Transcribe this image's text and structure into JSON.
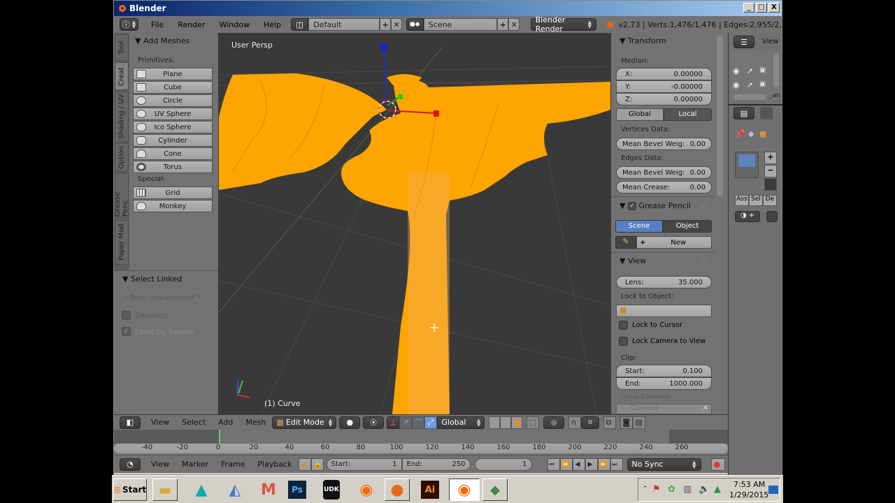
{
  "window": {
    "title": "Blender",
    "controls": [
      "_",
      "□",
      "X"
    ]
  },
  "topbar": {
    "menus": [
      "File",
      "Render",
      "Window",
      "Help"
    ],
    "screen_layout": "Default",
    "scene": "Scene",
    "render_engine": "Blender Render",
    "stats": "v2.73 | Verts:1,476/1,476 | Edges:2,955/2,"
  },
  "toolshelf": {
    "tabs": [
      "Tool",
      "Creat",
      "Shading / UV",
      "Option",
      "Grease Penc",
      "Paper Mod"
    ],
    "active_tab": "Creat",
    "panel_title": "Add Meshes",
    "primitives_label": "Primitives:",
    "primitives": [
      {
        "label": "Plane",
        "icon": "plane-icon"
      },
      {
        "label": "Cube",
        "icon": "cube-icon"
      },
      {
        "label": "Circle",
        "icon": "circle-icon"
      },
      {
        "label": "UV Sphere",
        "icon": "uv-sphere-icon"
      },
      {
        "label": "Ico Sphere",
        "icon": "ico-sphere-icon"
      },
      {
        "label": "Cylinder",
        "icon": "cylinder-icon"
      },
      {
        "label": "Cone",
        "icon": "cone-icon"
      },
      {
        "label": "Torus",
        "icon": "torus-icon"
      }
    ],
    "special_label": "Special:",
    "special": [
      {
        "label": "Grid",
        "icon": "grid-icon"
      },
      {
        "label": "Monkey",
        "icon": "monkey-icon"
      }
    ]
  },
  "operator_panel": {
    "title": "Select Linked",
    "note": "* Redo Unsupported *",
    "deselect": {
      "label": "Deselect",
      "checked": false
    },
    "limit_by_seams": {
      "label": "Limit by Seams",
      "checked": true
    }
  },
  "viewport": {
    "view_label": "User Persp",
    "object_label": "(1) Curve",
    "mesh_color": "#ffa500",
    "background": "#393939"
  },
  "npanel": {
    "transform": {
      "title": "Transform",
      "median_label": "Median:",
      "x": {
        "label": "X:",
        "value": "0.00000"
      },
      "y": {
        "label": "Y:",
        "value": "-0.00000"
      },
      "z": {
        "label": "Z:",
        "value": "0.00000"
      },
      "global_label": "Global",
      "local_label": "Local",
      "active_space": "Local",
      "vertices_label": "Vertices Data:",
      "vert_bevel": "Mean Bevel Weig:",
      "vert_bevel_value": "0.00",
      "edges_label": "Edges Data:",
      "edge_bevel": "Mean Bevel Weig:",
      "edge_bevel_value": "0.00",
      "crease_label": "Mean Crease:",
      "crease_value": "0.00"
    },
    "grease_pencil": {
      "title": "Grease Pencil",
      "enabled": true,
      "scene_label": "Scene",
      "object_label": "Object",
      "active": "Scene",
      "new_label": "New"
    },
    "view": {
      "title": "View",
      "lens_label": "Lens:",
      "lens_value": "35.000",
      "lock_object_label": "Lock to Object:",
      "lock_cursor_label": "Lock to Cursor",
      "lock_camera_label": "Lock Camera to View",
      "clip_label": "Clip:",
      "clip_start_label": "Start:",
      "clip_start_value": "0.100",
      "clip_end_label": "End:",
      "clip_end_value": "1000.000",
      "local_camera_label": "Local Camera:",
      "camera_value": "Camera"
    }
  },
  "outliner": {
    "view_label": "View",
    "item_suffix": "_an"
  },
  "properties": {
    "buttons": [
      "Ass",
      "Sel",
      "De"
    ]
  },
  "view3d_header": {
    "menus": [
      "View",
      "Select",
      "Add",
      "Mesh"
    ],
    "mode": "Edit Mode",
    "orientation": "Global"
  },
  "timeline": {
    "ticks": [
      "-40",
      "-20",
      "0",
      "20",
      "40",
      "60",
      "80",
      "100",
      "120",
      "140",
      "160",
      "180",
      "200",
      "220",
      "240",
      "260"
    ],
    "current_frame_marker": 0,
    "menus": [
      "View",
      "Marker",
      "Frame",
      "Playback"
    ],
    "start_label": "Start:",
    "start_value": "1",
    "end_label": "End:",
    "end_value": "250",
    "current_frame": "1",
    "sync": "No Sync"
  },
  "taskbar": {
    "start_label": "Start",
    "apps": [
      "explorer",
      "maya",
      "autodesk",
      "mudbox",
      "Ps",
      "UDK",
      "blender",
      "firefox",
      "Ai",
      "blender-active",
      "other"
    ],
    "ps_label": "Ps",
    "udk_label": "UDK",
    "ai_label": "Ai",
    "time": "7:53 AM",
    "date": "1/29/2015"
  }
}
